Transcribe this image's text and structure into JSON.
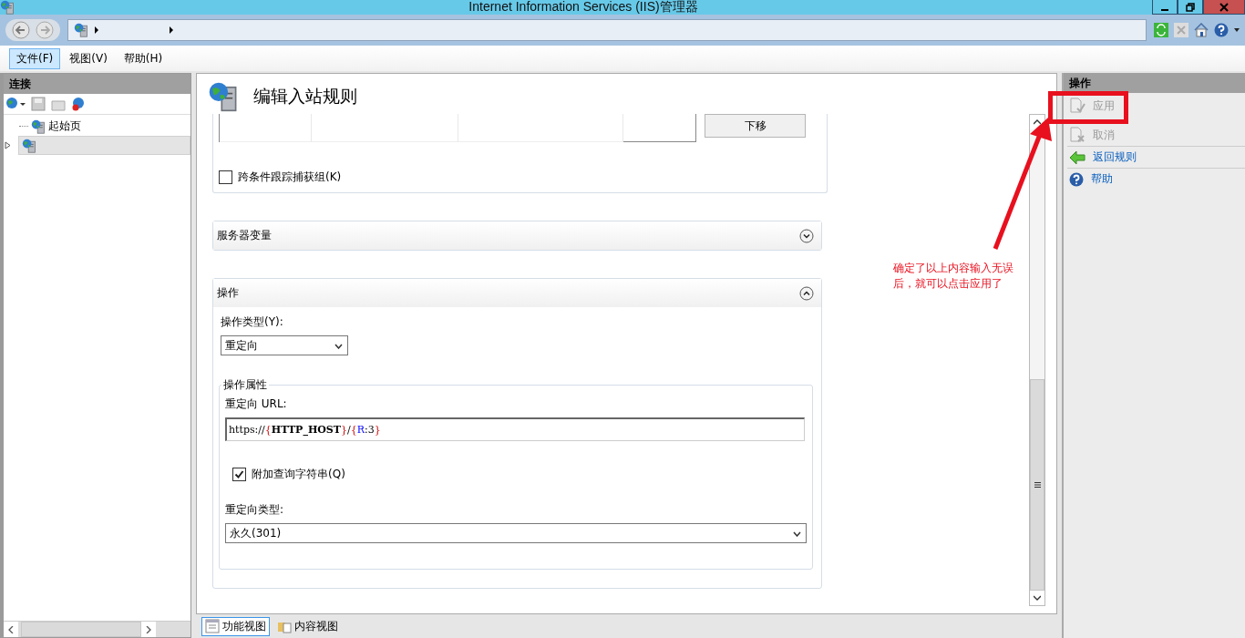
{
  "window": {
    "title": "Internet Information Services (IIS)管理器"
  },
  "menu": [
    {
      "label": "文件(F)",
      "selected": true
    },
    {
      "label": "视图(V)",
      "selected": false
    },
    {
      "label": "帮助(H)",
      "selected": false
    }
  ],
  "connections": {
    "title": "连接",
    "tree": [
      {
        "label": "起始页",
        "selected": false,
        "has_children": false
      },
      {
        "selected": true,
        "has_children": true
      }
    ]
  },
  "page": {
    "title": "编辑入站规则",
    "move_down_button": "下移",
    "track_capture_groups": {
      "label": "跨条件跟踪捕获组(K)",
      "checked": false
    },
    "sections": [
      {
        "title": "服务器变量",
        "expanded": false
      },
      {
        "title": "操作",
        "expanded": true
      }
    ],
    "action_type": {
      "label": "操作类型(Y):",
      "value": "重定向"
    },
    "action_properties": {
      "title": "操作属性",
      "url_label": "重定向 URL:",
      "url": [
        {
          "text": "https://",
          "kind": "plain"
        },
        {
          "text": "{",
          "kind": "brace"
        },
        {
          "text": "HTTP_HOST",
          "kind": "server-var"
        },
        {
          "text": "}",
          "kind": "brace"
        },
        {
          "text": "/",
          "kind": "plain"
        },
        {
          "text": "{",
          "kind": "brace"
        },
        {
          "text": "R",
          "kind": "back-ref"
        },
        {
          "text": ":3",
          "kind": "plain"
        },
        {
          "text": "}",
          "kind": "brace"
        }
      ],
      "append_query": {
        "label": "附加查询字符串(Q)",
        "checked": true
      },
      "redirect_type": {
        "label": "重定向类型:",
        "value": "永久(301)"
      }
    }
  },
  "view_tabs": [
    {
      "label": "功能视图",
      "selected": true
    },
    {
      "label": "内容视图",
      "selected": false
    }
  ],
  "actions": {
    "title": "操作",
    "items": [
      {
        "label": "应用",
        "kind": "apply",
        "disabled": true
      },
      {
        "label": "取消",
        "kind": "cancel",
        "disabled": true
      },
      {
        "label": "返回规则",
        "kind": "back",
        "disabled": false
      },
      {
        "label": "帮助",
        "kind": "help",
        "disabled": false
      }
    ]
  },
  "annotation": {
    "text": "确定了以上内容输入无误后，就可以点击应用了"
  }
}
